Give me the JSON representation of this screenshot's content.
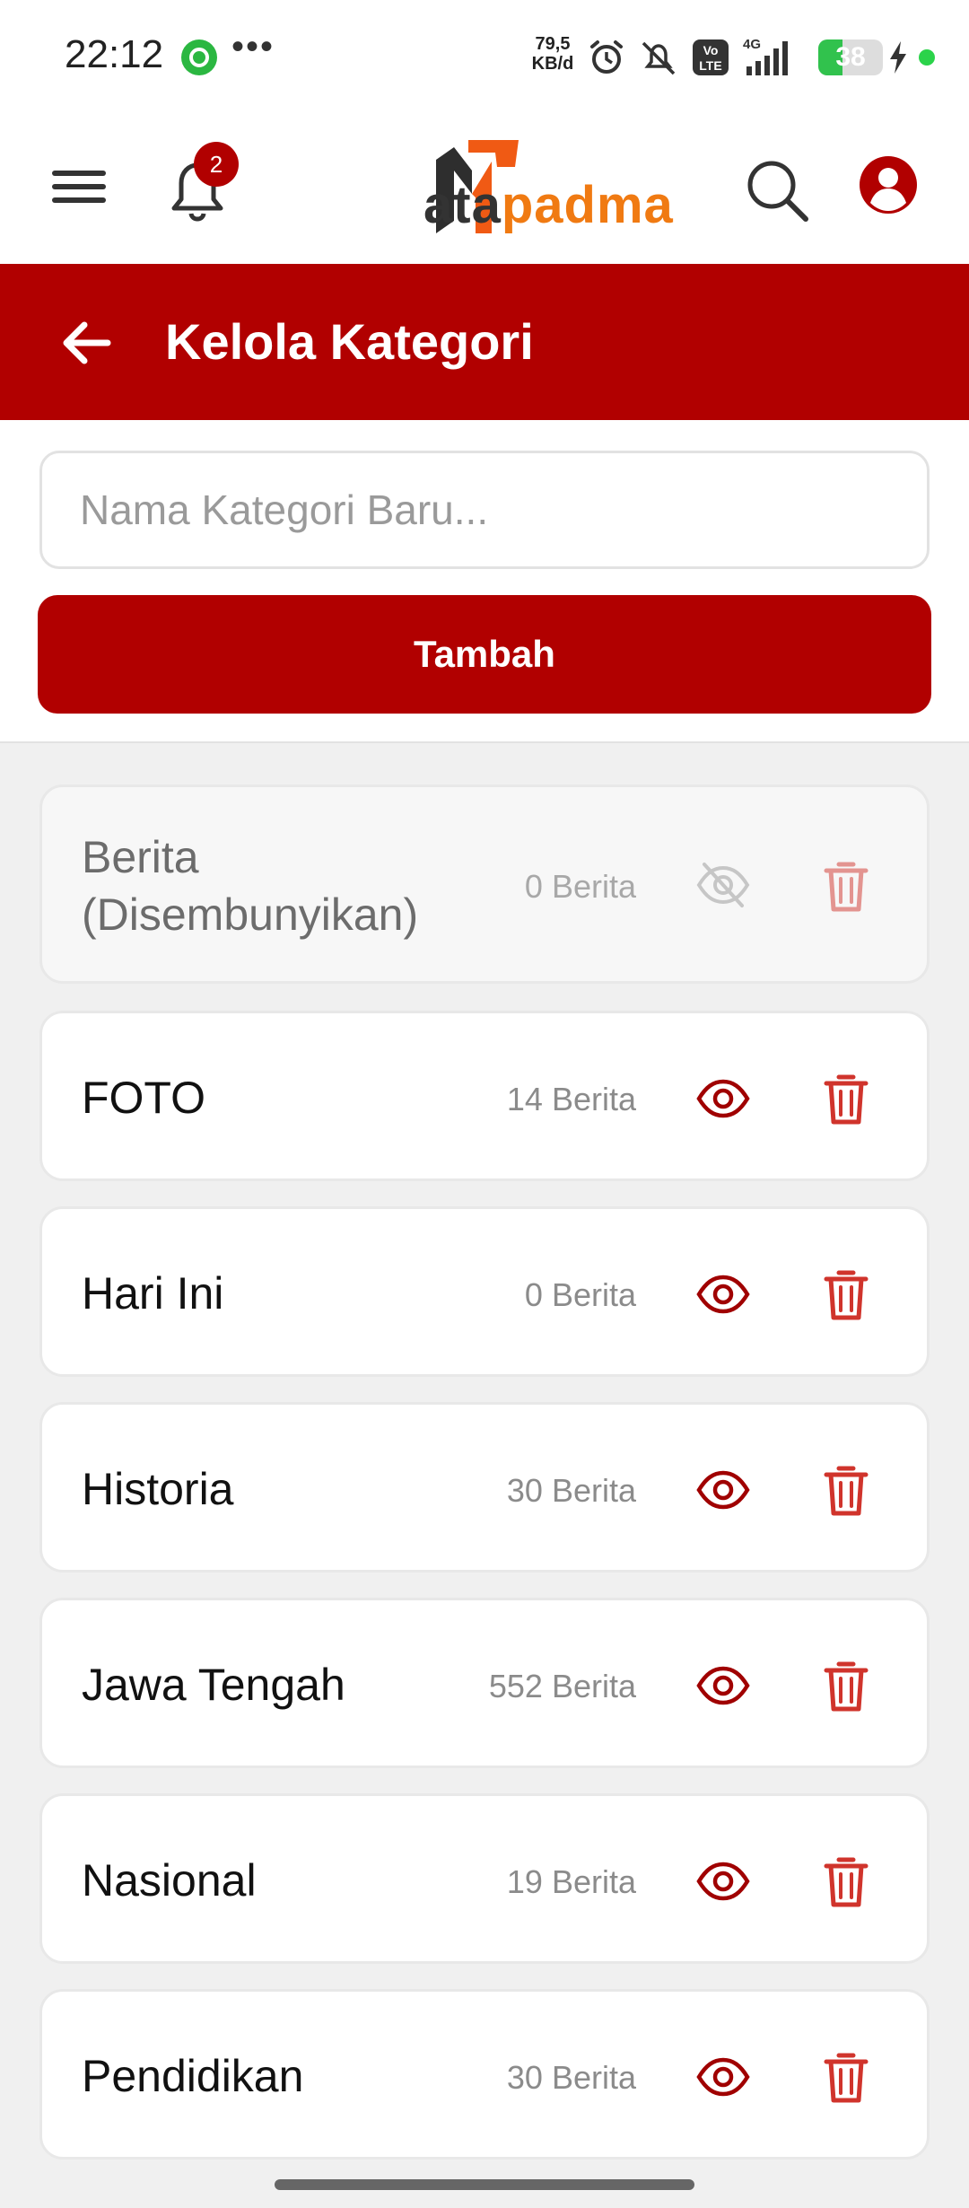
{
  "status_bar": {
    "time": "22:12",
    "net_speed_value": "79,5",
    "net_speed_unit": "KB/d",
    "network": "4G",
    "volte": "Vo LTE",
    "battery": "38",
    "icons": [
      "whatsapp-icon",
      "more-icon",
      "alarm-icon",
      "mute-icon",
      "volte-icon",
      "signal-icon",
      "battery-icon",
      "charging-icon"
    ]
  },
  "header": {
    "logo_text_dark": "ata",
    "logo_text_accent": "padma",
    "notification_count": "2",
    "icons": [
      "menu-icon",
      "bell-icon",
      "search-icon",
      "profile-icon"
    ]
  },
  "page": {
    "title": "Kelola Kategori"
  },
  "form": {
    "placeholder": "Nama Kategori Baru...",
    "value": "",
    "button_label": "Tambah"
  },
  "categories": [
    {
      "name": "Berita (Disembunyikan)",
      "count": "0 Berita",
      "visible": false
    },
    {
      "name": "FOTO",
      "count": "14 Berita",
      "visible": true
    },
    {
      "name": "Hari Ini",
      "count": "0 Berita",
      "visible": true
    },
    {
      "name": "Historia",
      "count": "30 Berita",
      "visible": true
    },
    {
      "name": "Jawa Tengah",
      "count": "552 Berita",
      "visible": true
    },
    {
      "name": "Nasional",
      "count": "19 Berita",
      "visible": true
    },
    {
      "name": "Pendidikan",
      "count": "30 Berita",
      "visible": true
    }
  ],
  "colors": {
    "brand_red": "#b10000",
    "logo_orange": "#f07a12",
    "eye_red": "#a00000",
    "trash_red": "#d0342c"
  }
}
